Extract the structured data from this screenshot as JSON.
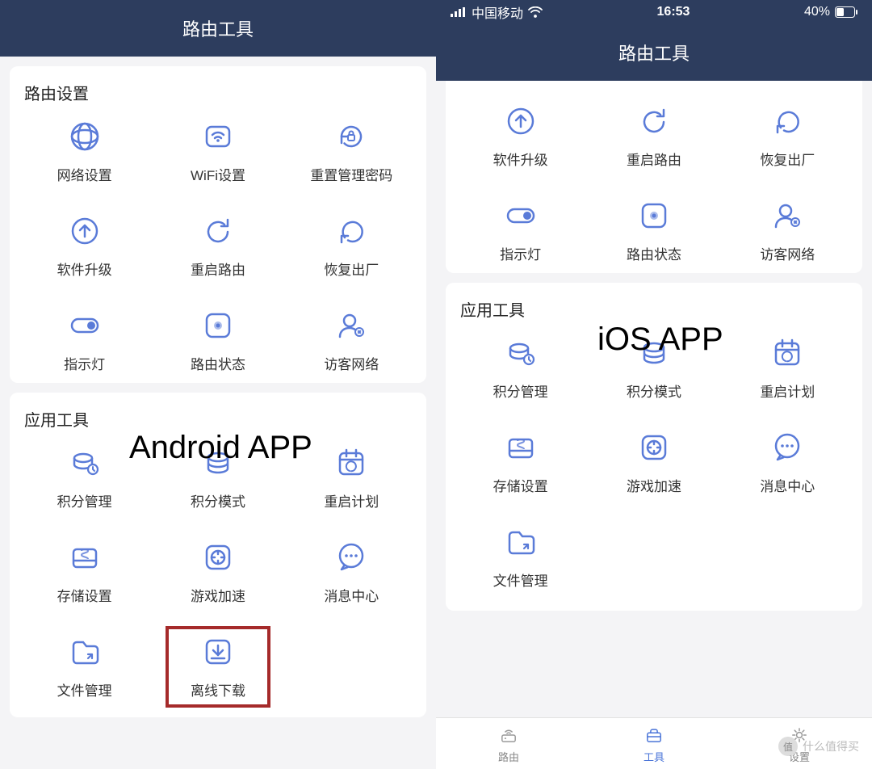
{
  "header_title": "路由工具",
  "status": {
    "carrier": "中国移动",
    "time": "16:53",
    "battery": "40%"
  },
  "sections": {
    "settings_title": "路由设置",
    "apps_title": "应用工具"
  },
  "android": {
    "label": "Android APP",
    "settings": [
      {
        "label": "网络设置",
        "icon": "globe"
      },
      {
        "label": "WiFi设置",
        "icon": "wifi-box"
      },
      {
        "label": "重置管理密码",
        "icon": "lock-reset"
      },
      {
        "label": "软件升级",
        "icon": "upgrade"
      },
      {
        "label": "重启路由",
        "icon": "restart"
      },
      {
        "label": "恢复出厂",
        "icon": "factory"
      },
      {
        "label": "指示灯",
        "icon": "toggle"
      },
      {
        "label": "路由状态",
        "icon": "status"
      },
      {
        "label": "访客网络",
        "icon": "guest"
      }
    ],
    "apps": [
      {
        "label": "积分管理",
        "icon": "points-mgmt"
      },
      {
        "label": "积分模式",
        "icon": "points-mode"
      },
      {
        "label": "重启计划",
        "icon": "schedule"
      },
      {
        "label": "存储设置",
        "icon": "storage"
      },
      {
        "label": "游戏加速",
        "icon": "game-boost"
      },
      {
        "label": "消息中心",
        "icon": "message"
      },
      {
        "label": "文件管理",
        "icon": "file"
      },
      {
        "label": "离线下载",
        "icon": "download",
        "highlight": true
      }
    ]
  },
  "ios": {
    "label": "iOS APP",
    "settings_partial": [
      {
        "label": "软件升级",
        "icon": "upgrade"
      },
      {
        "label": "重启路由",
        "icon": "restart"
      },
      {
        "label": "恢复出厂",
        "icon": "factory"
      },
      {
        "label": "指示灯",
        "icon": "toggle"
      },
      {
        "label": "路由状态",
        "icon": "status"
      },
      {
        "label": "访客网络",
        "icon": "guest"
      }
    ],
    "apps": [
      {
        "label": "积分管理",
        "icon": "points-mgmt"
      },
      {
        "label": "积分模式",
        "icon": "points-mode"
      },
      {
        "label": "重启计划",
        "icon": "schedule"
      },
      {
        "label": "存储设置",
        "icon": "storage"
      },
      {
        "label": "游戏加速",
        "icon": "game-boost"
      },
      {
        "label": "消息中心",
        "icon": "message"
      },
      {
        "label": "文件管理",
        "icon": "file"
      }
    ]
  },
  "tabs": [
    {
      "label": "路由",
      "icon": "router",
      "active": false
    },
    {
      "label": "工具",
      "icon": "toolbox",
      "active": true
    },
    {
      "label": "设置",
      "icon": "gear",
      "active": false
    }
  ],
  "watermark": "什么值得买"
}
